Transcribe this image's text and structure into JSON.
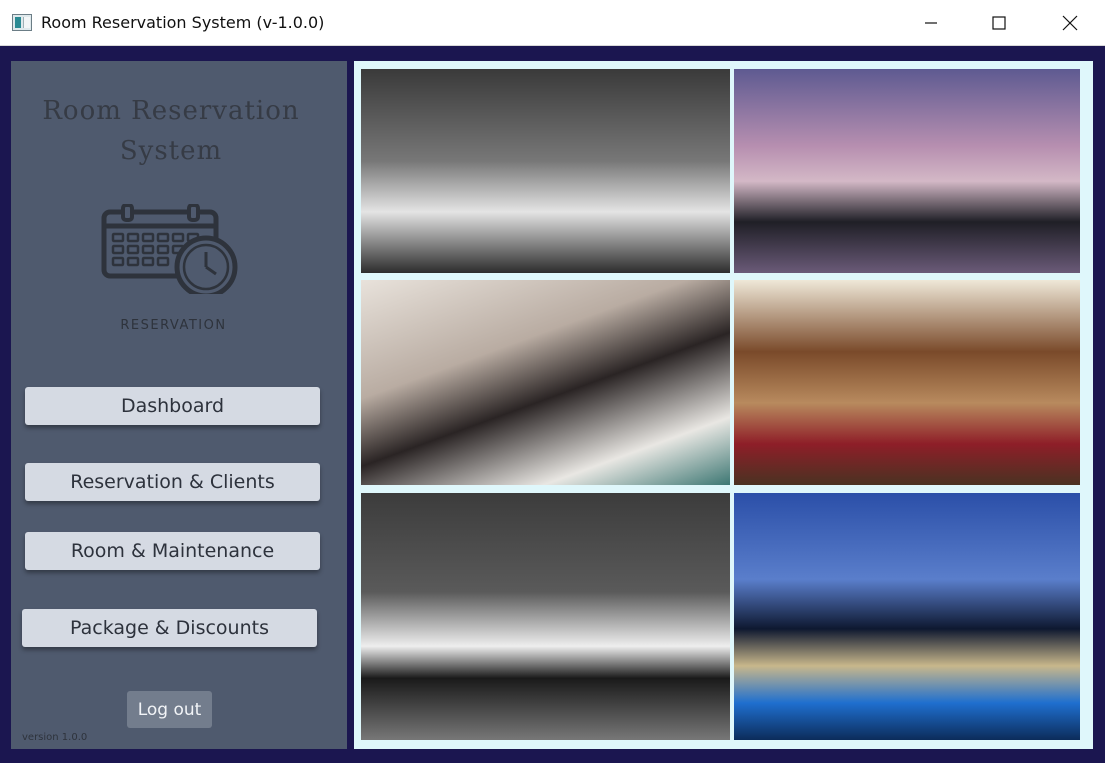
{
  "window": {
    "title": "Room Reservation System (v-1.0.0)",
    "icon": "app-window-icon",
    "controls": [
      "minimize-icon",
      "maximize-icon",
      "close-icon"
    ]
  },
  "sidebar": {
    "title_line1": "Room Reservation",
    "title_line2": "System",
    "logo_icon": "calendar-clock-icon",
    "logo_label": "RESERVATION",
    "nav": {
      "dashboard": "Dashboard",
      "reservation": "Reservation & Clients",
      "room": "Room & Maintenance",
      "package": "Package & Discounts"
    },
    "logout_label": "Log out",
    "version": "version 1.0.0"
  },
  "gallery": {
    "images": [
      "hotel-bedroom-photo",
      "resort-pool-palms-photo",
      "housekeeper-making-bed-photo",
      "room-disinfection-photo",
      "modern-bedroom-photo",
      "resort-pool-night-photo"
    ]
  },
  "colors": {
    "frame_background": "#1b1650",
    "sidebar": "#4f5a6e",
    "nav_button": "#d5dae3",
    "logout_button": "#737d8d",
    "gallery_background": "#dff7fb"
  }
}
